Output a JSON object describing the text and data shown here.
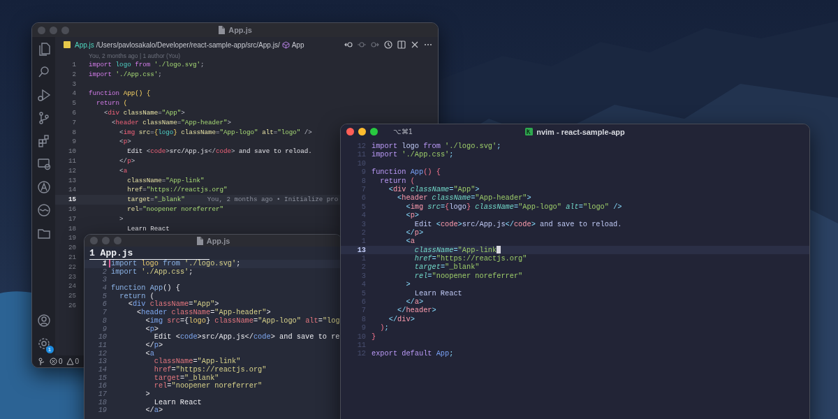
{
  "vscode_window": {
    "title": "App.js",
    "focused": false,
    "breadcrumb": {
      "file": "App.js",
      "path": "/Users/pavlosakalo/Developer/react-sample-app/src/App.js/",
      "symbol": "App"
    },
    "blame": "You, 2 months ago | 1 author (You)",
    "lines": [
      {
        "number": "1",
        "current": false,
        "tokens": [
          {
            "kind": "keyword",
            "text": "import "
          },
          {
            "kind": "name",
            "text": "logo "
          },
          {
            "kind": "keyword",
            "text": "from "
          },
          {
            "kind": "string",
            "text": "'./logo.svg'"
          },
          {
            "kind": "punct",
            "text": ";"
          }
        ]
      },
      {
        "number": "2",
        "current": false,
        "tokens": [
          {
            "kind": "keyword",
            "text": "import "
          },
          {
            "kind": "string",
            "text": "'./App.css'"
          },
          {
            "kind": "punct",
            "text": ";"
          }
        ]
      },
      {
        "number": "3",
        "current": false
      },
      {
        "number": "4",
        "current": false,
        "tokens": [
          {
            "kind": "keyword",
            "text": "function "
          },
          {
            "kind": "function",
            "text": "App"
          },
          {
            "kind": "brace",
            "text": "() {"
          }
        ]
      },
      {
        "number": "5",
        "current": false,
        "tokens": [
          {
            "kind": "keyword",
            "text": "  return "
          },
          {
            "kind": "brace",
            "text": "("
          }
        ]
      },
      {
        "number": "6",
        "current": false,
        "tokens": [
          {
            "kind": "punct",
            "text": "    <"
          },
          {
            "kind": "tag",
            "text": "div "
          },
          {
            "kind": "attr",
            "text": "className"
          },
          {
            "kind": "punct",
            "text": "="
          },
          {
            "kind": "string",
            "text": "\"App\""
          },
          {
            "kind": "punct",
            "text": ">"
          }
        ]
      },
      {
        "number": "7",
        "current": false,
        "tokens": [
          {
            "kind": "punct",
            "text": "      <"
          },
          {
            "kind": "tag",
            "text": "header "
          },
          {
            "kind": "attr",
            "text": "className"
          },
          {
            "kind": "punct",
            "text": "="
          },
          {
            "kind": "string",
            "text": "\"App-header\""
          },
          {
            "kind": "punct",
            "text": ">"
          }
        ]
      },
      {
        "number": "8",
        "current": false,
        "tokens": [
          {
            "kind": "punct",
            "text": "        <"
          },
          {
            "kind": "tag",
            "text": "img "
          },
          {
            "kind": "attr",
            "text": "src"
          },
          {
            "kind": "punct",
            "text": "="
          },
          {
            "kind": "brace",
            "text": "{"
          },
          {
            "kind": "name",
            "text": "logo"
          },
          {
            "kind": "brace",
            "text": "} "
          },
          {
            "kind": "attr",
            "text": "className"
          },
          {
            "kind": "punct",
            "text": "="
          },
          {
            "kind": "string",
            "text": "\"App-logo\" "
          },
          {
            "kind": "attr",
            "text": "alt"
          },
          {
            "kind": "punct",
            "text": "="
          },
          {
            "kind": "string",
            "text": "\"logo\" "
          },
          {
            "kind": "punct",
            "text": "/>"
          }
        ]
      },
      {
        "number": "9",
        "current": false,
        "tokens": [
          {
            "kind": "punct",
            "text": "        <"
          },
          {
            "kind": "tag",
            "text": "p"
          },
          {
            "kind": "punct",
            "text": ">"
          }
        ]
      },
      {
        "number": "10",
        "current": false,
        "tokens": [
          {
            "kind": "text",
            "text": "          Edit "
          },
          {
            "kind": "punct",
            "text": "<"
          },
          {
            "kind": "tag",
            "text": "code"
          },
          {
            "kind": "punct",
            "text": ">"
          },
          {
            "kind": "text",
            "text": "src/App.js"
          },
          {
            "kind": "punct",
            "text": "</"
          },
          {
            "kind": "tag",
            "text": "code"
          },
          {
            "kind": "punct",
            "text": ">"
          },
          {
            "kind": "text",
            "text": " and save to reload."
          }
        ]
      },
      {
        "number": "11",
        "current": false,
        "tokens": [
          {
            "kind": "punct",
            "text": "        </"
          },
          {
            "kind": "tag",
            "text": "p"
          },
          {
            "kind": "punct",
            "text": ">"
          }
        ]
      },
      {
        "number": "12",
        "current": false,
        "tokens": [
          {
            "kind": "punct",
            "text": "        <"
          },
          {
            "kind": "tag",
            "text": "a"
          }
        ]
      },
      {
        "number": "13",
        "current": false,
        "tokens": [
          {
            "kind": "attr",
            "text": "          className"
          },
          {
            "kind": "punct",
            "text": "="
          },
          {
            "kind": "string",
            "text": "\"App-link\""
          }
        ]
      },
      {
        "number": "14",
        "current": false,
        "tokens": [
          {
            "kind": "attr",
            "text": "          href"
          },
          {
            "kind": "punct",
            "text": "="
          },
          {
            "kind": "string",
            "text": "\"https://reactjs.org\""
          }
        ]
      },
      {
        "number": "15",
        "current": true,
        "tokens": [
          {
            "kind": "attr",
            "text": "          target"
          },
          {
            "kind": "punct",
            "text": "="
          },
          {
            "kind": "string",
            "text": "\"_blank\""
          }
        ],
        "annotation": "You, 2 months ago • Initialize pro"
      },
      {
        "number": "16",
        "current": false,
        "tokens": [
          {
            "kind": "attr",
            "text": "          rel"
          },
          {
            "kind": "punct",
            "text": "="
          },
          {
            "kind": "string",
            "text": "\"noopener noreferrer\""
          }
        ]
      },
      {
        "number": "17",
        "current": false,
        "tokens": [
          {
            "kind": "punct",
            "text": "        >"
          }
        ]
      },
      {
        "number": "18",
        "current": false,
        "tokens": [
          {
            "kind": "text",
            "text": "          Learn React"
          }
        ]
      },
      {
        "number": "19",
        "current": false
      },
      {
        "number": "20",
        "current": false
      },
      {
        "number": "21",
        "current": false
      },
      {
        "number": "22",
        "current": false
      },
      {
        "number": "23",
        "current": false
      },
      {
        "number": "24",
        "current": false
      },
      {
        "number": "25",
        "current": false
      },
      {
        "number": "26",
        "current": false
      }
    ],
    "settings_badge": "1",
    "status_bar": {
      "errors": "0",
      "warnings": "0"
    }
  },
  "vim_window": {
    "title": "App.js",
    "focused": false,
    "tab": "1 App.js",
    "cursor": {
      "kind": "bar"
    },
    "lines": [
      {
        "number": "1",
        "current": true,
        "tokens": [
          {
            "kind": "keyword",
            "text": "import "
          },
          {
            "kind": "name",
            "text": "logo "
          },
          {
            "kind": "keyword",
            "text": "from "
          },
          {
            "kind": "string",
            "text": "'./logo.svg'"
          },
          {
            "kind": "punct",
            "text": ";"
          }
        ]
      },
      {
        "number": "2",
        "current": false,
        "tokens": [
          {
            "kind": "keyword",
            "text": "import "
          },
          {
            "kind": "string",
            "text": "'./App.css'"
          },
          {
            "kind": "punct",
            "text": ";"
          }
        ]
      },
      {
        "number": "3",
        "current": false
      },
      {
        "number": "4",
        "current": false,
        "tokens": [
          {
            "kind": "keyword",
            "text": "function "
          },
          {
            "kind": "function",
            "text": "App"
          },
          {
            "kind": "brace",
            "text": "() {"
          }
        ]
      },
      {
        "number": "5",
        "current": false,
        "tokens": [
          {
            "kind": "keyword",
            "text": "  return "
          },
          {
            "kind": "brace",
            "text": "("
          }
        ]
      },
      {
        "number": "6",
        "current": false,
        "tokens": [
          {
            "kind": "punct",
            "text": "    <"
          },
          {
            "kind": "tag",
            "text": "div "
          },
          {
            "kind": "attr",
            "text": "className"
          },
          {
            "kind": "punct",
            "text": "="
          },
          {
            "kind": "string",
            "text": "\"App\""
          },
          {
            "kind": "punct",
            "text": ">"
          }
        ]
      },
      {
        "number": "7",
        "current": false,
        "tokens": [
          {
            "kind": "punct",
            "text": "      <"
          },
          {
            "kind": "tag",
            "text": "header "
          },
          {
            "kind": "attr",
            "text": "className"
          },
          {
            "kind": "punct",
            "text": "="
          },
          {
            "kind": "string",
            "text": "\"App-header\""
          },
          {
            "kind": "punct",
            "text": ">"
          }
        ]
      },
      {
        "number": "8",
        "current": false,
        "tokens": [
          {
            "kind": "punct",
            "text": "        <"
          },
          {
            "kind": "tag",
            "text": "img "
          },
          {
            "kind": "attr",
            "text": "src"
          },
          {
            "kind": "punct",
            "text": "="
          },
          {
            "kind": "brace",
            "text": "{"
          },
          {
            "kind": "name",
            "text": "logo"
          },
          {
            "kind": "brace",
            "text": "} "
          },
          {
            "kind": "attr",
            "text": "className"
          },
          {
            "kind": "punct",
            "text": "="
          },
          {
            "kind": "string",
            "text": "\"App-logo\" "
          },
          {
            "kind": "attr",
            "text": "alt"
          },
          {
            "kind": "punct",
            "text": "="
          },
          {
            "kind": "string",
            "text": "\"log"
          }
        ]
      },
      {
        "number": "9",
        "current": false,
        "tokens": [
          {
            "kind": "punct",
            "text": "        <"
          },
          {
            "kind": "tag",
            "text": "p"
          },
          {
            "kind": "punct",
            "text": ">"
          }
        ]
      },
      {
        "number": "10",
        "current": false,
        "tokens": [
          {
            "kind": "text",
            "text": "          Edit "
          },
          {
            "kind": "punct",
            "text": "<"
          },
          {
            "kind": "tag",
            "text": "code"
          },
          {
            "kind": "punct",
            "text": ">"
          },
          {
            "kind": "text",
            "text": "src/App.js"
          },
          {
            "kind": "punct",
            "text": "</"
          },
          {
            "kind": "tag",
            "text": "code"
          },
          {
            "kind": "punct",
            "text": ">"
          },
          {
            "kind": "text",
            "text": " and save to re"
          }
        ]
      },
      {
        "number": "11",
        "current": false,
        "tokens": [
          {
            "kind": "punct",
            "text": "        </"
          },
          {
            "kind": "tag",
            "text": "p"
          },
          {
            "kind": "punct",
            "text": ">"
          }
        ]
      },
      {
        "number": "12",
        "current": false,
        "tokens": [
          {
            "kind": "punct",
            "text": "        <"
          },
          {
            "kind": "tag",
            "text": "a"
          }
        ]
      },
      {
        "number": "13",
        "current": false,
        "tokens": [
          {
            "kind": "attr",
            "text": "          className"
          },
          {
            "kind": "punct",
            "text": "="
          },
          {
            "kind": "string",
            "text": "\"App-link\""
          }
        ]
      },
      {
        "number": "14",
        "current": false,
        "tokens": [
          {
            "kind": "attr",
            "text": "          href"
          },
          {
            "kind": "punct",
            "text": "="
          },
          {
            "kind": "string",
            "text": "\"https://reactjs.org\""
          }
        ]
      },
      {
        "number": "15",
        "current": false,
        "tokens": [
          {
            "kind": "attr",
            "text": "          target"
          },
          {
            "kind": "punct",
            "text": "="
          },
          {
            "kind": "string",
            "text": "\"_blank\""
          }
        ]
      },
      {
        "number": "16",
        "current": false,
        "tokens": [
          {
            "kind": "attr",
            "text": "          rel"
          },
          {
            "kind": "punct",
            "text": "="
          },
          {
            "kind": "string",
            "text": "\"noopener noreferrer\""
          }
        ]
      },
      {
        "number": "17",
        "current": false,
        "tokens": [
          {
            "kind": "punct",
            "text": "        >"
          }
        ]
      },
      {
        "number": "18",
        "current": false,
        "tokens": [
          {
            "kind": "text",
            "text": "          Learn React"
          }
        ]
      },
      {
        "number": "19",
        "current": false,
        "tokens": [
          {
            "kind": "punct",
            "text": "        </"
          },
          {
            "kind": "tag",
            "text": "a"
          },
          {
            "kind": "punct",
            "text": ">"
          }
        ]
      }
    ]
  },
  "nvim_window": {
    "shortcut": "⌥⌘1",
    "title": "nvim - react-sample-app",
    "focused": true,
    "cursor": {
      "kind": "block"
    },
    "lines": [
      {
        "number": "12",
        "current": false,
        "tokens": [
          {
            "kind": "keyword",
            "text": "import "
          },
          {
            "kind": "name",
            "text": "logo "
          },
          {
            "kind": "keyword",
            "text": "from "
          },
          {
            "kind": "string",
            "text": "'./logo.svg'"
          },
          {
            "kind": "punct",
            "text": ";"
          }
        ]
      },
      {
        "number": "11",
        "current": false,
        "tokens": [
          {
            "kind": "keyword",
            "text": "import "
          },
          {
            "kind": "string",
            "text": "'./App.css'"
          },
          {
            "kind": "punct",
            "text": ";"
          }
        ]
      },
      {
        "number": "10",
        "current": false
      },
      {
        "number": "9",
        "current": false,
        "tokens": [
          {
            "kind": "keyword",
            "text": "function "
          },
          {
            "kind": "function",
            "text": "App"
          },
          {
            "kind": "brace",
            "text": "() {"
          }
        ]
      },
      {
        "number": "8",
        "current": false,
        "tokens": [
          {
            "kind": "keyword",
            "text": "  return "
          },
          {
            "kind": "brace",
            "text": "("
          }
        ]
      },
      {
        "number": "7",
        "current": false,
        "tokens": [
          {
            "kind": "punct",
            "text": "    <"
          },
          {
            "kind": "tag",
            "text": "div "
          },
          {
            "kind": "attr",
            "text": "className"
          },
          {
            "kind": "punct",
            "text": "="
          },
          {
            "kind": "string",
            "text": "\"App\""
          },
          {
            "kind": "punct",
            "text": ">"
          }
        ]
      },
      {
        "number": "6",
        "current": false,
        "tokens": [
          {
            "kind": "punct",
            "text": "      <"
          },
          {
            "kind": "tag",
            "text": "header "
          },
          {
            "kind": "attr",
            "text": "className"
          },
          {
            "kind": "punct",
            "text": "="
          },
          {
            "kind": "string",
            "text": "\"App-header\""
          },
          {
            "kind": "punct",
            "text": ">"
          }
        ]
      },
      {
        "number": "5",
        "current": false,
        "tokens": [
          {
            "kind": "punct",
            "text": "        <"
          },
          {
            "kind": "tag",
            "text": "img "
          },
          {
            "kind": "attr",
            "text": "src"
          },
          {
            "kind": "punct",
            "text": "="
          },
          {
            "kind": "brace",
            "text": "{"
          },
          {
            "kind": "name",
            "text": "logo"
          },
          {
            "kind": "brace",
            "text": "} "
          },
          {
            "kind": "attr",
            "text": "className"
          },
          {
            "kind": "punct",
            "text": "="
          },
          {
            "kind": "string",
            "text": "\"App-logo\" "
          },
          {
            "kind": "attr",
            "text": "alt"
          },
          {
            "kind": "punct",
            "text": "="
          },
          {
            "kind": "string",
            "text": "\"logo\" "
          },
          {
            "kind": "punct",
            "text": "/>"
          }
        ]
      },
      {
        "number": "4",
        "current": false,
        "tokens": [
          {
            "kind": "punct",
            "text": "        <"
          },
          {
            "kind": "tag",
            "text": "p"
          },
          {
            "kind": "punct",
            "text": ">"
          }
        ]
      },
      {
        "number": "3",
        "current": false,
        "tokens": [
          {
            "kind": "text",
            "text": "          Edit "
          },
          {
            "kind": "punct",
            "text": "<"
          },
          {
            "kind": "tag",
            "text": "code"
          },
          {
            "kind": "punct",
            "text": ">"
          },
          {
            "kind": "text",
            "text": "src/App.js"
          },
          {
            "kind": "punct",
            "text": "</"
          },
          {
            "kind": "tag",
            "text": "code"
          },
          {
            "kind": "punct",
            "text": ">"
          },
          {
            "kind": "text",
            "text": " and save to reload."
          }
        ]
      },
      {
        "number": "2",
        "current": false,
        "tokens": [
          {
            "kind": "punct",
            "text": "        </"
          },
          {
            "kind": "tag",
            "text": "p"
          },
          {
            "kind": "punct",
            "text": ">"
          }
        ]
      },
      {
        "number": "1",
        "current": false,
        "tokens": [
          {
            "kind": "punct",
            "text": "        <"
          },
          {
            "kind": "tag",
            "text": "a"
          }
        ]
      },
      {
        "number": "13",
        "current": true,
        "tokens": [
          {
            "kind": "attr",
            "text": "          className"
          },
          {
            "kind": "punct",
            "text": "="
          },
          {
            "kind": "string",
            "text": "\"App-link"
          }
        ]
      },
      {
        "number": "1",
        "current": false,
        "tokens": [
          {
            "kind": "attr",
            "text": "          href"
          },
          {
            "kind": "punct",
            "text": "="
          },
          {
            "kind": "string",
            "text": "\"https://reactjs.org\""
          }
        ]
      },
      {
        "number": "2",
        "current": false,
        "tokens": [
          {
            "kind": "attr",
            "text": "          target"
          },
          {
            "kind": "punct",
            "text": "="
          },
          {
            "kind": "string",
            "text": "\"_blank\""
          }
        ]
      },
      {
        "number": "3",
        "current": false,
        "tokens": [
          {
            "kind": "attr",
            "text": "          rel"
          },
          {
            "kind": "punct",
            "text": "="
          },
          {
            "kind": "string",
            "text": "\"noopener noreferrer\""
          }
        ]
      },
      {
        "number": "4",
        "current": false,
        "tokens": [
          {
            "kind": "punct",
            "text": "        >"
          }
        ]
      },
      {
        "number": "5",
        "current": false,
        "tokens": [
          {
            "kind": "text",
            "text": "          Learn React"
          }
        ]
      },
      {
        "number": "6",
        "current": false,
        "tokens": [
          {
            "kind": "punct",
            "text": "        </"
          },
          {
            "kind": "tag",
            "text": "a"
          },
          {
            "kind": "punct",
            "text": ">"
          }
        ]
      },
      {
        "number": "7",
        "current": false,
        "tokens": [
          {
            "kind": "punct",
            "text": "      </"
          },
          {
            "kind": "tag",
            "text": "header"
          },
          {
            "kind": "punct",
            "text": ">"
          }
        ]
      },
      {
        "number": "8",
        "current": false,
        "tokens": [
          {
            "kind": "punct",
            "text": "    </"
          },
          {
            "kind": "tag",
            "text": "div"
          },
          {
            "kind": "punct",
            "text": ">"
          }
        ]
      },
      {
        "number": "9",
        "current": false,
        "tokens": [
          {
            "kind": "brace",
            "text": "  )"
          },
          {
            "kind": "punct",
            "text": ";"
          }
        ]
      },
      {
        "number": "10",
        "current": false,
        "tokens": [
          {
            "kind": "brace",
            "text": "}"
          }
        ]
      },
      {
        "number": "11",
        "current": false
      },
      {
        "number": "12",
        "current": false,
        "tokens": [
          {
            "kind": "keyword",
            "text": "export default "
          },
          {
            "kind": "function",
            "text": "App"
          },
          {
            "kind": "punct",
            "text": ";"
          }
        ]
      }
    ]
  }
}
